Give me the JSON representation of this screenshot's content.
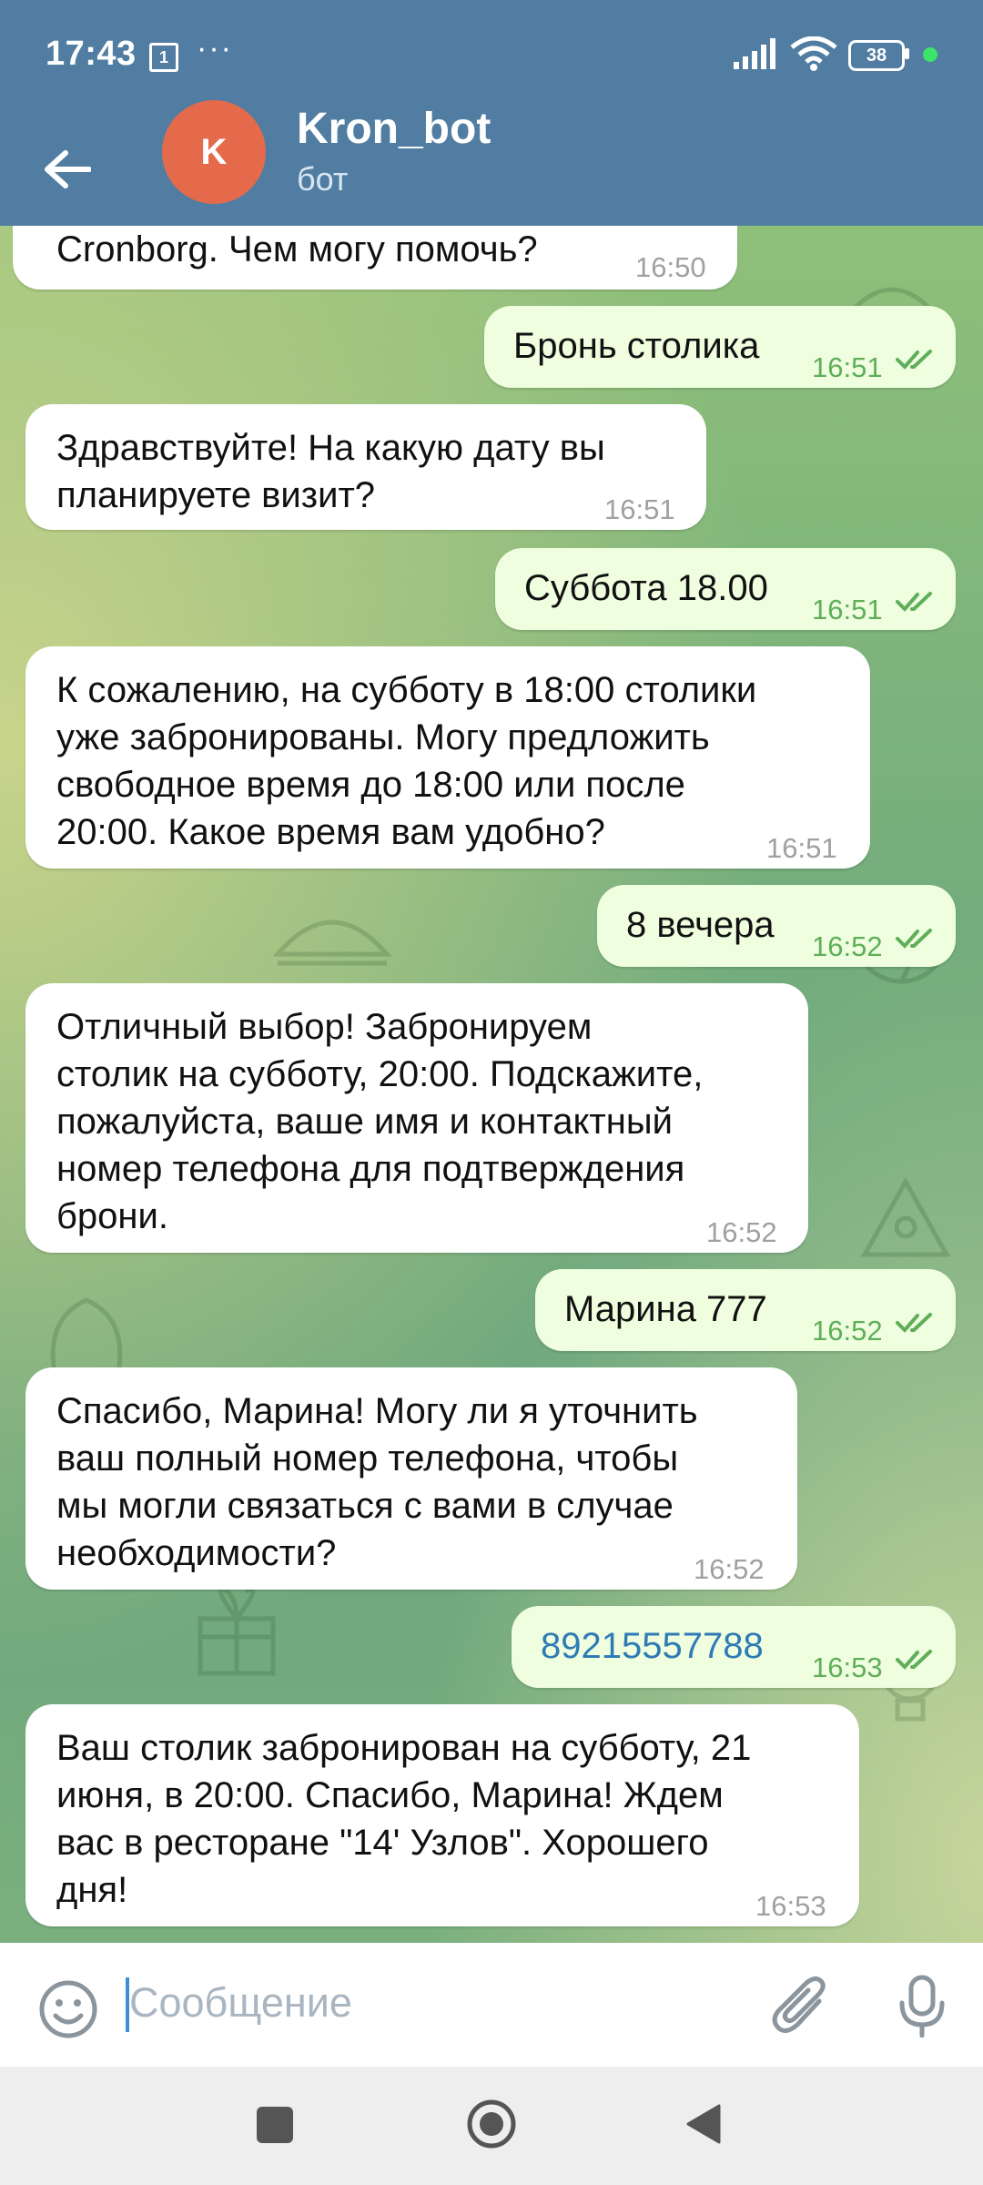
{
  "status_bar": {
    "time": "17:43",
    "notification_badge": "1",
    "more": "···",
    "battery_level": "38",
    "icons": [
      "calendar-badge-icon",
      "signal-icon",
      "wifi-icon",
      "battery-icon"
    ]
  },
  "header": {
    "back_icon": "arrow-left-icon",
    "avatar_letter": "K",
    "avatar_color": "#e56a4b",
    "title": "Kron_bot",
    "subtitle": "бот",
    "menu_icon": "more-vertical-icon"
  },
  "messages": [
    {
      "dir": "in",
      "lines": [
        "Cronborg. Чем могу помочь?"
      ],
      "time": "16:50"
    },
    {
      "dir": "out",
      "lines": [
        "Бронь столика"
      ],
      "time": "16:51",
      "read": true
    },
    {
      "dir": "in",
      "lines": [
        "Здравствуйте! На какую дату вы",
        "планируете визит?"
      ],
      "time": "16:51"
    },
    {
      "dir": "out",
      "lines": [
        "Суббота 18.00"
      ],
      "time": "16:51",
      "read": true
    },
    {
      "dir": "in",
      "lines": [
        "К сожалению, на субботу в 18:00 столики",
        "уже забронированы. Могу предложить",
        "свободное время до 18:00 или после",
        "20:00. Какое время вам удобно?"
      ],
      "time": "16:51"
    },
    {
      "dir": "out",
      "lines": [
        "8 вечера"
      ],
      "time": "16:52",
      "read": true
    },
    {
      "dir": "in",
      "lines": [
        "Отличный выбор! Забронируем",
        "столик на субботу, 20:00. Подскажите,",
        "пожалуйста, ваше имя и контактный",
        "номер телефона для подтверждения",
        "брони."
      ],
      "time": "16:52"
    },
    {
      "dir": "out",
      "lines": [
        "Марина 777"
      ],
      "time": "16:52",
      "read": true
    },
    {
      "dir": "in",
      "lines": [
        "Спасибо, Марина! Могу ли я уточнить",
        "ваш полный номер телефона, чтобы",
        "мы могли связаться с вами в случае",
        "необходимости?"
      ],
      "time": "16:52"
    },
    {
      "dir": "out",
      "lines": [
        "89215557788"
      ],
      "time": "16:53",
      "read": true,
      "link": true
    },
    {
      "dir": "in",
      "lines": [
        "Ваш столик забронирован на субботу, 21",
        "июня, в 20:00. Спасибо, Марина! Ждем",
        "вас в ресторане \"14' Узлов\". Хорошего",
        "дня!"
      ],
      "time": "16:53"
    }
  ],
  "composer": {
    "placeholder": "Сообщение",
    "icons": [
      "emoji-icon",
      "attach-icon",
      "microphone-icon"
    ]
  },
  "navbar": {
    "icons": [
      "recents-square-icon",
      "home-circle-icon",
      "back-triangle-icon"
    ]
  },
  "colors": {
    "header": "#517da2",
    "incoming_bubble": "#ffffff",
    "outgoing_bubble": "#eefedf",
    "outgoing_time": "#5fae5a",
    "link": "#2f7bb5"
  }
}
